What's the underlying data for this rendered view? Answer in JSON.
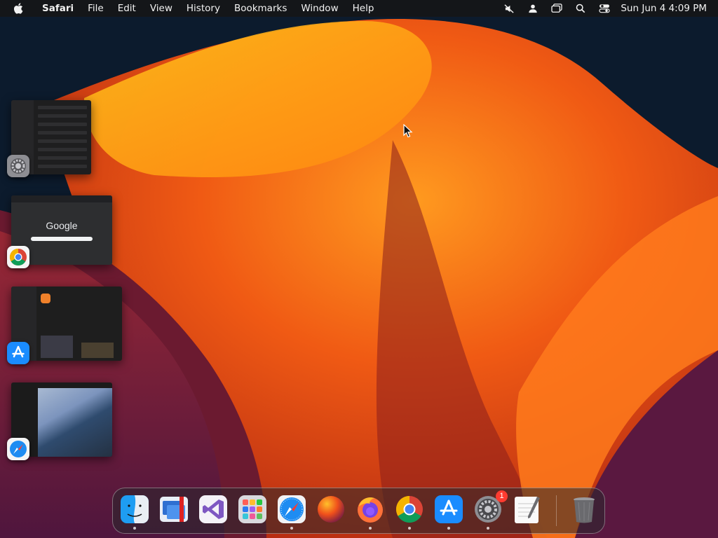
{
  "menubar": {
    "app_name": "Safari",
    "menus": [
      "File",
      "Edit",
      "View",
      "History",
      "Bookmarks",
      "Window",
      "Help"
    ],
    "status_icons": [
      "mute-icon",
      "user-icon",
      "screen-mirroring-icon",
      "spotlight-search-icon",
      "control-center-icon"
    ],
    "clock": "Sun Jun 4  4:09 PM"
  },
  "thumbnails": {
    "chrome_logo_text": "Google"
  },
  "stage_manager": [
    {
      "app": "System Settings",
      "icon": "settings-gear-icon"
    },
    {
      "app": "Google Chrome",
      "icon": "chrome-icon"
    },
    {
      "app": "App Store",
      "icon": "app-store-icon"
    },
    {
      "app": "Safari",
      "icon": "safari-icon"
    }
  ],
  "dock": {
    "items": [
      {
        "name": "Finder",
        "icon": "finder-icon",
        "running": true
      },
      {
        "name": "Remote Desktop",
        "icon": "remote-desktop-icon",
        "running": false
      },
      {
        "name": "Visual Studio",
        "icon": "visual-studio-icon",
        "running": false
      },
      {
        "name": "Launchpad",
        "icon": "launchpad-icon",
        "running": false
      },
      {
        "name": "Safari",
        "icon": "safari-icon",
        "running": true
      },
      {
        "name": "macOS Ventura",
        "icon": "ventura-icon",
        "running": false
      },
      {
        "name": "Firefox",
        "icon": "firefox-icon",
        "running": true
      },
      {
        "name": "Google Chrome",
        "icon": "chrome-icon",
        "running": true
      },
      {
        "name": "App Store",
        "icon": "app-store-icon",
        "running": true
      },
      {
        "name": "System Settings",
        "icon": "settings-gear-icon",
        "running": true,
        "badge": "1"
      },
      {
        "name": "TextEdit",
        "icon": "textedit-icon",
        "running": false
      },
      {
        "name": "Trash",
        "icon": "trash-icon",
        "running": false
      }
    ]
  },
  "colors": {
    "accent_orange": "#f47a1a",
    "badge_red": "#ff3b30",
    "menubar_bg": "#161618"
  }
}
